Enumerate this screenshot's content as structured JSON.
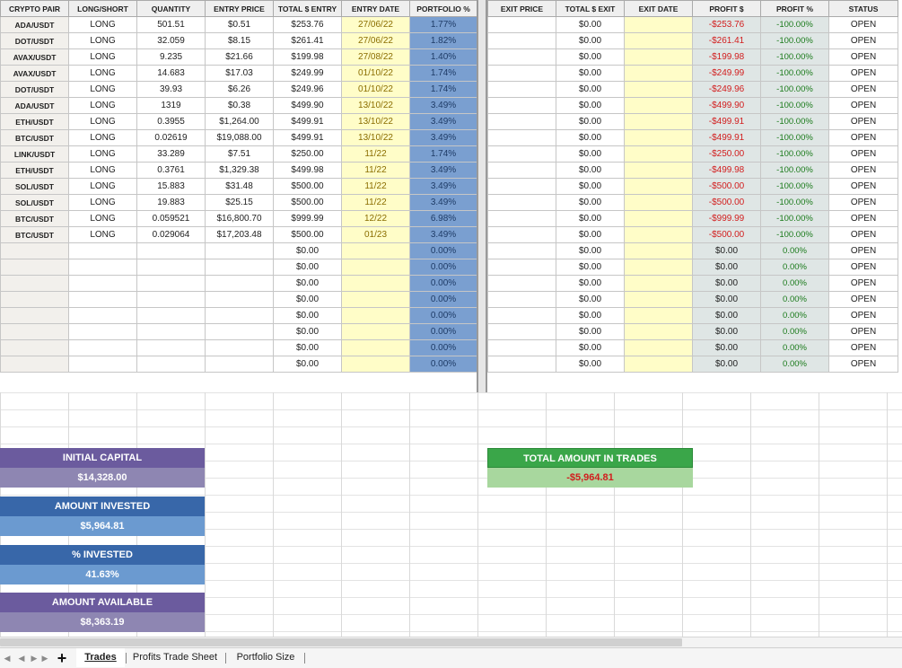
{
  "trades_headers": {
    "left": [
      "CRYPTO PAIR",
      "LONG/SHORT",
      "QUANTITY",
      "ENTRY PRICE",
      "TOTAL $ ENTRY",
      "ENTRY DATE",
      "PORTFOLIO %"
    ],
    "right": [
      "EXIT PRICE",
      "TOTAL $ EXIT",
      "EXIT DATE",
      "PROFIT $",
      "PROFIT %",
      "STATUS"
    ]
  },
  "rows": [
    {
      "pair": "ADA/USDT",
      "side": "LONG",
      "qty": "501.51",
      "entry_price": "$0.51",
      "total_entry": "$253.76",
      "entry_date": "27/06/22",
      "portfolio": "1.77%",
      "exit_price": "",
      "total_exit": "$0.00",
      "exit_date": "",
      "profit": "-$253.76",
      "profit_pct": "-100.00%",
      "status": "OPEN"
    },
    {
      "pair": "DOT/USDT",
      "side": "LONG",
      "qty": "32.059",
      "entry_price": "$8.15",
      "total_entry": "$261.41",
      "entry_date": "27/06/22",
      "portfolio": "1.82%",
      "exit_price": "",
      "total_exit": "$0.00",
      "exit_date": "",
      "profit": "-$261.41",
      "profit_pct": "-100.00%",
      "status": "OPEN"
    },
    {
      "pair": "AVAX/USDT",
      "side": "LONG",
      "qty": "9.235",
      "entry_price": "$21.66",
      "total_entry": "$199.98",
      "entry_date": "27/08/22",
      "portfolio": "1.40%",
      "exit_price": "",
      "total_exit": "$0.00",
      "exit_date": "",
      "profit": "-$199.98",
      "profit_pct": "-100.00%",
      "status": "OPEN"
    },
    {
      "pair": "AVAX/USDT",
      "side": "LONG",
      "qty": "14.683",
      "entry_price": "$17.03",
      "total_entry": "$249.99",
      "entry_date": "01/10/22",
      "portfolio": "1.74%",
      "exit_price": "",
      "total_exit": "$0.00",
      "exit_date": "",
      "profit": "-$249.99",
      "profit_pct": "-100.00%",
      "status": "OPEN"
    },
    {
      "pair": "DOT/USDT",
      "side": "LONG",
      "qty": "39.93",
      "entry_price": "$6.26",
      "total_entry": "$249.96",
      "entry_date": "01/10/22",
      "portfolio": "1.74%",
      "exit_price": "",
      "total_exit": "$0.00",
      "exit_date": "",
      "profit": "-$249.96",
      "profit_pct": "-100.00%",
      "status": "OPEN"
    },
    {
      "pair": "ADA/USDT",
      "side": "LONG",
      "qty": "1319",
      "entry_price": "$0.38",
      "total_entry": "$499.90",
      "entry_date": "13/10/22",
      "portfolio": "3.49%",
      "exit_price": "",
      "total_exit": "$0.00",
      "exit_date": "",
      "profit": "-$499.90",
      "profit_pct": "-100.00%",
      "status": "OPEN"
    },
    {
      "pair": "ETH/USDT",
      "side": "LONG",
      "qty": "0.3955",
      "entry_price": "$1,264.00",
      "total_entry": "$499.91",
      "entry_date": "13/10/22",
      "portfolio": "3.49%",
      "exit_price": "",
      "total_exit": "$0.00",
      "exit_date": "",
      "profit": "-$499.91",
      "profit_pct": "-100.00%",
      "status": "OPEN"
    },
    {
      "pair": "BTC/USDT",
      "side": "LONG",
      "qty": "0.02619",
      "entry_price": "$19,088.00",
      "total_entry": "$499.91",
      "entry_date": "13/10/22",
      "portfolio": "3.49%",
      "exit_price": "",
      "total_exit": "$0.00",
      "exit_date": "",
      "profit": "-$499.91",
      "profit_pct": "-100.00%",
      "status": "OPEN"
    },
    {
      "pair": "LINK/USDT",
      "side": "LONG",
      "qty": "33.289",
      "entry_price": "$7.51",
      "total_entry": "$250.00",
      "entry_date": "11/22",
      "portfolio": "1.74%",
      "exit_price": "",
      "total_exit": "$0.00",
      "exit_date": "",
      "profit": "-$250.00",
      "profit_pct": "-100.00%",
      "status": "OPEN"
    },
    {
      "pair": "ETH/USDT",
      "side": "LONG",
      "qty": "0.3761",
      "entry_price": "$1,329.38",
      "total_entry": "$499.98",
      "entry_date": "11/22",
      "portfolio": "3.49%",
      "exit_price": "",
      "total_exit": "$0.00",
      "exit_date": "",
      "profit": "-$499.98",
      "profit_pct": "-100.00%",
      "status": "OPEN"
    },
    {
      "pair": "SOL/USDT",
      "side": "LONG",
      "qty": "15.883",
      "entry_price": "$31.48",
      "total_entry": "$500.00",
      "entry_date": "11/22",
      "portfolio": "3.49%",
      "exit_price": "",
      "total_exit": "$0.00",
      "exit_date": "",
      "profit": "-$500.00",
      "profit_pct": "-100.00%",
      "status": "OPEN"
    },
    {
      "pair": "SOL/USDT",
      "side": "LONG",
      "qty": "19.883",
      "entry_price": "$25.15",
      "total_entry": "$500.00",
      "entry_date": "11/22",
      "portfolio": "3.49%",
      "exit_price": "",
      "total_exit": "$0.00",
      "exit_date": "",
      "profit": "-$500.00",
      "profit_pct": "-100.00%",
      "status": "OPEN"
    },
    {
      "pair": "BTC/USDT",
      "side": "LONG",
      "qty": "0.059521",
      "entry_price": "$16,800.70",
      "total_entry": "$999.99",
      "entry_date": "12/22",
      "portfolio": "6.98%",
      "exit_price": "",
      "total_exit": "$0.00",
      "exit_date": "",
      "profit": "-$999.99",
      "profit_pct": "-100.00%",
      "status": "OPEN"
    },
    {
      "pair": "BTC/USDT",
      "side": "LONG",
      "qty": "0.029064",
      "entry_price": "$17,203.48",
      "total_entry": "$500.00",
      "entry_date": "01/23",
      "portfolio": "3.49%",
      "exit_price": "",
      "total_exit": "$0.00",
      "exit_date": "",
      "profit": "-$500.00",
      "profit_pct": "-100.00%",
      "status": "OPEN"
    },
    {
      "pair": "",
      "side": "",
      "qty": "",
      "entry_price": "",
      "total_entry": "$0.00",
      "entry_date": "",
      "portfolio": "0.00%",
      "exit_price": "",
      "total_exit": "$0.00",
      "exit_date": "",
      "profit": "$0.00",
      "profit_pct": "0.00%",
      "status": "OPEN"
    },
    {
      "pair": "",
      "side": "",
      "qty": "",
      "entry_price": "",
      "total_entry": "$0.00",
      "entry_date": "",
      "portfolio": "0.00%",
      "exit_price": "",
      "total_exit": "$0.00",
      "exit_date": "",
      "profit": "$0.00",
      "profit_pct": "0.00%",
      "status": "OPEN"
    },
    {
      "pair": "",
      "side": "",
      "qty": "",
      "entry_price": "",
      "total_entry": "$0.00",
      "entry_date": "",
      "portfolio": "0.00%",
      "exit_price": "",
      "total_exit": "$0.00",
      "exit_date": "",
      "profit": "$0.00",
      "profit_pct": "0.00%",
      "status": "OPEN"
    },
    {
      "pair": "",
      "side": "",
      "qty": "",
      "entry_price": "",
      "total_entry": "$0.00",
      "entry_date": "",
      "portfolio": "0.00%",
      "exit_price": "",
      "total_exit": "$0.00",
      "exit_date": "",
      "profit": "$0.00",
      "profit_pct": "0.00%",
      "status": "OPEN"
    },
    {
      "pair": "",
      "side": "",
      "qty": "",
      "entry_price": "",
      "total_entry": "$0.00",
      "entry_date": "",
      "portfolio": "0.00%",
      "exit_price": "",
      "total_exit": "$0.00",
      "exit_date": "",
      "profit": "$0.00",
      "profit_pct": "0.00%",
      "status": "OPEN"
    },
    {
      "pair": "",
      "side": "",
      "qty": "",
      "entry_price": "",
      "total_entry": "$0.00",
      "entry_date": "",
      "portfolio": "0.00%",
      "exit_price": "",
      "total_exit": "$0.00",
      "exit_date": "",
      "profit": "$0.00",
      "profit_pct": "0.00%",
      "status": "OPEN"
    },
    {
      "pair": "",
      "side": "",
      "qty": "",
      "entry_price": "",
      "total_entry": "$0.00",
      "entry_date": "",
      "portfolio": "0.00%",
      "exit_price": "",
      "total_exit": "$0.00",
      "exit_date": "",
      "profit": "$0.00",
      "profit_pct": "0.00%",
      "status": "OPEN"
    },
    {
      "pair": "",
      "side": "",
      "qty": "",
      "entry_price": "",
      "total_entry": "$0.00",
      "entry_date": "",
      "portfolio": "0.00%",
      "exit_price": "",
      "total_exit": "$0.00",
      "exit_date": "",
      "profit": "$0.00",
      "profit_pct": "0.00%",
      "status": "OPEN"
    }
  ],
  "summary": {
    "initial_capital_label": "INITIAL CAPITAL",
    "initial_capital_value": "$14,328.00",
    "amount_invested_label": "AMOUNT INVESTED",
    "amount_invested_value": "$5,964.81",
    "pct_invested_label": "% INVESTED",
    "pct_invested_value": "41.63%",
    "amount_available_label": "AMOUNT AVAILABLE",
    "amount_available_value": "$8,363.19",
    "total_in_trades_label": "TOTAL AMOUNT IN TRADES",
    "total_in_trades_value": "-$5,964.81"
  },
  "tabs": {
    "add_sheet": "+",
    "items": [
      "Trades",
      "Profits Trade Sheet",
      "Portfolio Size"
    ],
    "active": "Trades"
  },
  "colors": {
    "negative": "#d21d1d",
    "positive_pct": "#1a7a1a",
    "portfolio_col": "#7a9fd0",
    "date_col": "#fffdc8",
    "summary_purple": "#6b5b9e",
    "summary_blue": "#3867a9",
    "summary_green": "#3aa649"
  },
  "icons": {
    "nav_first": "first-sheet-icon",
    "nav_prev": "prev-sheet-icon",
    "nav_next": "next-sheet-icon",
    "nav_last": "last-sheet-icon"
  }
}
